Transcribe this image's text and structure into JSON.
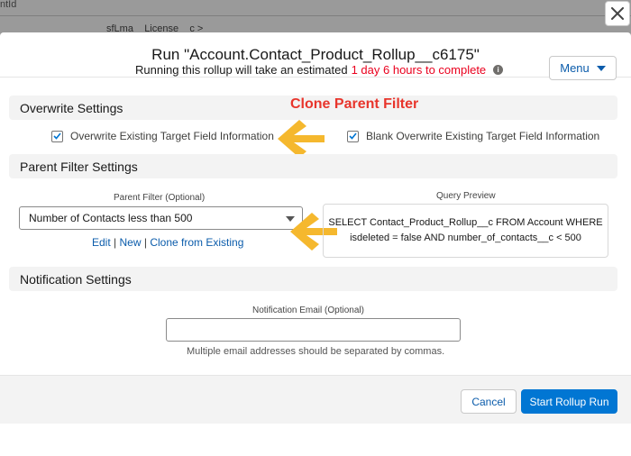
{
  "background": {
    "text_top": "ntId",
    "text_row": "sfLma__License__c >"
  },
  "modal": {
    "title": "Run \"Account.Contact_Product_Rollup__c6175\"",
    "estimate_prefix": "Running this rollup will take an estimated",
    "estimate_duration": "1 day 6 hours to complete",
    "menu_label": "Menu"
  },
  "overwrite": {
    "heading": "Overwrite Settings",
    "option1": "Overwrite Existing Target Field Information",
    "option1_checked": true,
    "option2": "Blank Overwrite Existing Target Field Information",
    "option2_checked": true
  },
  "annotation": {
    "title": "Clone Parent Filter",
    "color": "#e8352c",
    "arrow_color": "#f5b82e"
  },
  "parent_filter": {
    "heading": "Parent Filter Settings",
    "label": "Parent Filter (Optional)",
    "selected": "Number of Contacts less than 500",
    "link_edit": "Edit",
    "link_new": "New",
    "link_clone": "Clone from Existing",
    "separator": "|",
    "query_label": "Query Preview",
    "query_line1": "SELECT Contact_Product_Rollup__c FROM Account WHERE",
    "query_line2": "isdeleted = false AND number_of_contacts__c < 500"
  },
  "notification": {
    "heading": "Notification Settings",
    "email_label": "Notification Email (Optional)",
    "email_value": "",
    "help": "Multiple email addresses should be separated by commas."
  },
  "footer": {
    "cancel": "Cancel",
    "start": "Start Rollup Run"
  },
  "colors": {
    "brand": "#0176d3",
    "link": "#0b5cab",
    "warning": "#c23934",
    "estimate_red": "#ea001e"
  }
}
